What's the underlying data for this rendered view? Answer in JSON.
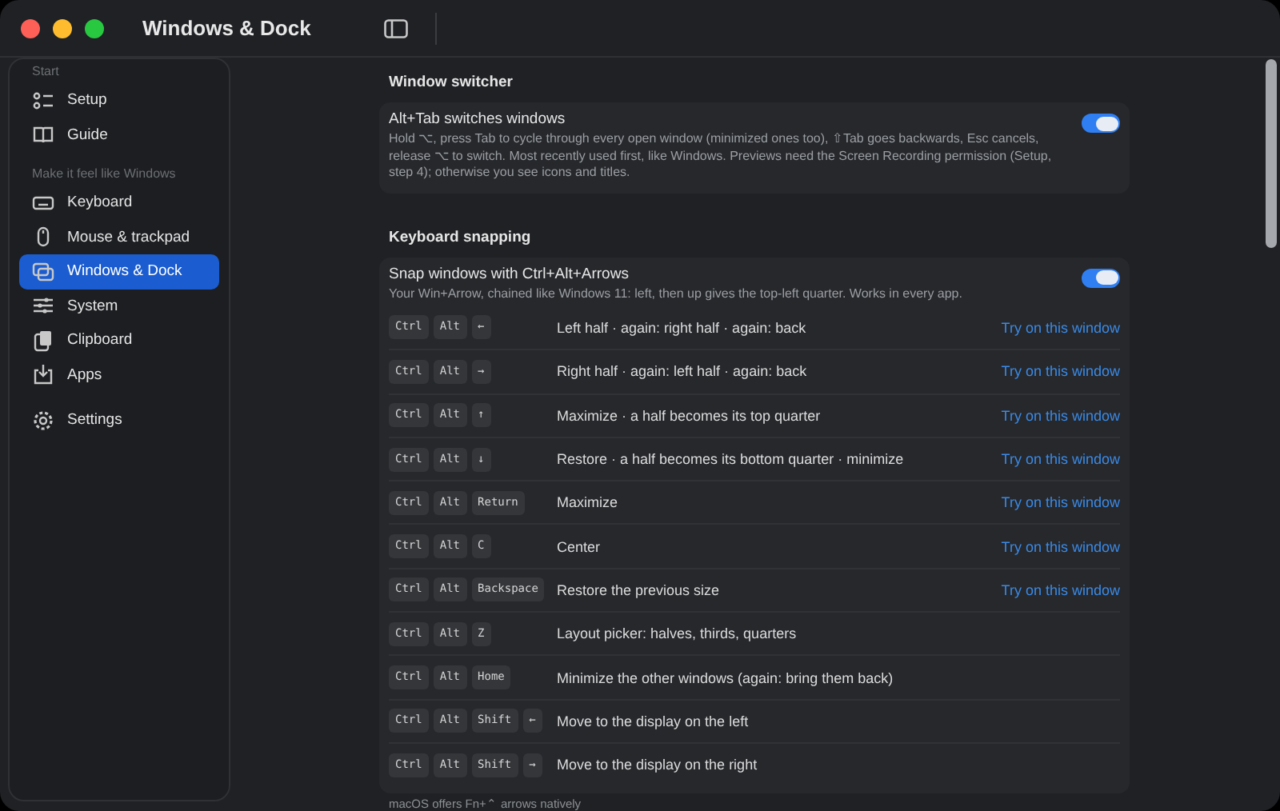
{
  "window": {
    "title": "Windows & Dock"
  },
  "sidebar": {
    "sections": [
      {
        "title": "Start",
        "items": [
          {
            "label": "Setup",
            "kind": "list",
            "selected": false
          },
          {
            "label": "Guide",
            "kind": "book",
            "selected": false
          }
        ]
      },
      {
        "title": "Make it feel like Windows",
        "items": [
          {
            "label": "Keyboard",
            "kind": "keyboard",
            "selected": false
          },
          {
            "label": "Mouse & trackpad",
            "kind": "mouse",
            "selected": false
          },
          {
            "label": "Windows & Dock",
            "kind": "windows",
            "selected": true
          },
          {
            "label": "System",
            "kind": "sliders",
            "selected": false
          },
          {
            "label": "Clipboard",
            "kind": "clipboard",
            "selected": false
          },
          {
            "label": "Apps",
            "kind": "download",
            "selected": false
          }
        ]
      },
      {
        "items": [
          {
            "label": "Settings",
            "kind": "gear",
            "selected": false
          }
        ]
      }
    ]
  },
  "sections": [
    {
      "title": "Window switcher",
      "toggle": {
        "label": "Alt+Tab switches windows",
        "description": "Hold ⌥, press Tab to cycle through every open window (minimized ones too), ⇧Tab goes backwards, Esc cancels, release ⌥ to switch. Most recently used first, like Windows. Previews need the Screen Recording permission (Setup, step 4); otherwise you see icons and titles.",
        "on": true
      }
    },
    {
      "title": "Keyboard snapping",
      "toggle": {
        "label": "Snap windows with Ctrl+Alt+Arrows",
        "description": "Your Win+Arrow, chained like Windows 11: left, then up gives the top-left quarter. Works in every app.",
        "on": true
      },
      "shortcuts": [
        {
          "keys": [
            "Ctrl",
            "Alt",
            "←"
          ],
          "action": "Left half · again: right half · again: back",
          "link": "Try on this window"
        },
        {
          "keys": [
            "Ctrl",
            "Alt",
            "→"
          ],
          "action": "Right half · again: left half · again: back",
          "link": "Try on this window"
        },
        {
          "keys": [
            "Ctrl",
            "Alt",
            "↑"
          ],
          "action": "Maximize · a half becomes its top quarter",
          "link": "Try on this window"
        },
        {
          "keys": [
            "Ctrl",
            "Alt",
            "↓"
          ],
          "action": "Restore · a half becomes its bottom quarter · minimize",
          "link": "Try on this window"
        },
        {
          "keys": [
            "Ctrl",
            "Alt",
            "Return"
          ],
          "action": "Maximize",
          "link": "Try on this window"
        },
        {
          "keys": [
            "Ctrl",
            "Alt",
            "C"
          ],
          "action": "Center",
          "link": "Try on this window"
        },
        {
          "keys": [
            "Ctrl",
            "Alt",
            "Backspace"
          ],
          "action": "Restore the previous size",
          "link": "Try on this window"
        },
        {
          "keys": [
            "Ctrl",
            "Alt",
            "Z"
          ],
          "action": "Layout picker: halves, thirds, quarters"
        },
        {
          "keys": [
            "Ctrl",
            "Alt",
            "Home"
          ],
          "action": "Minimize the other windows (again: bring them back)"
        },
        {
          "keys": [
            "Ctrl",
            "Alt",
            "Shift",
            "←"
          ],
          "action": "Move to the display on the left"
        },
        {
          "keys": [
            "Ctrl",
            "Alt",
            "Shift",
            "→"
          ],
          "action": "Move to the display on the right"
        }
      ],
      "footnote": "macOS offers Fn+⌃ arrows natively"
    }
  ]
}
